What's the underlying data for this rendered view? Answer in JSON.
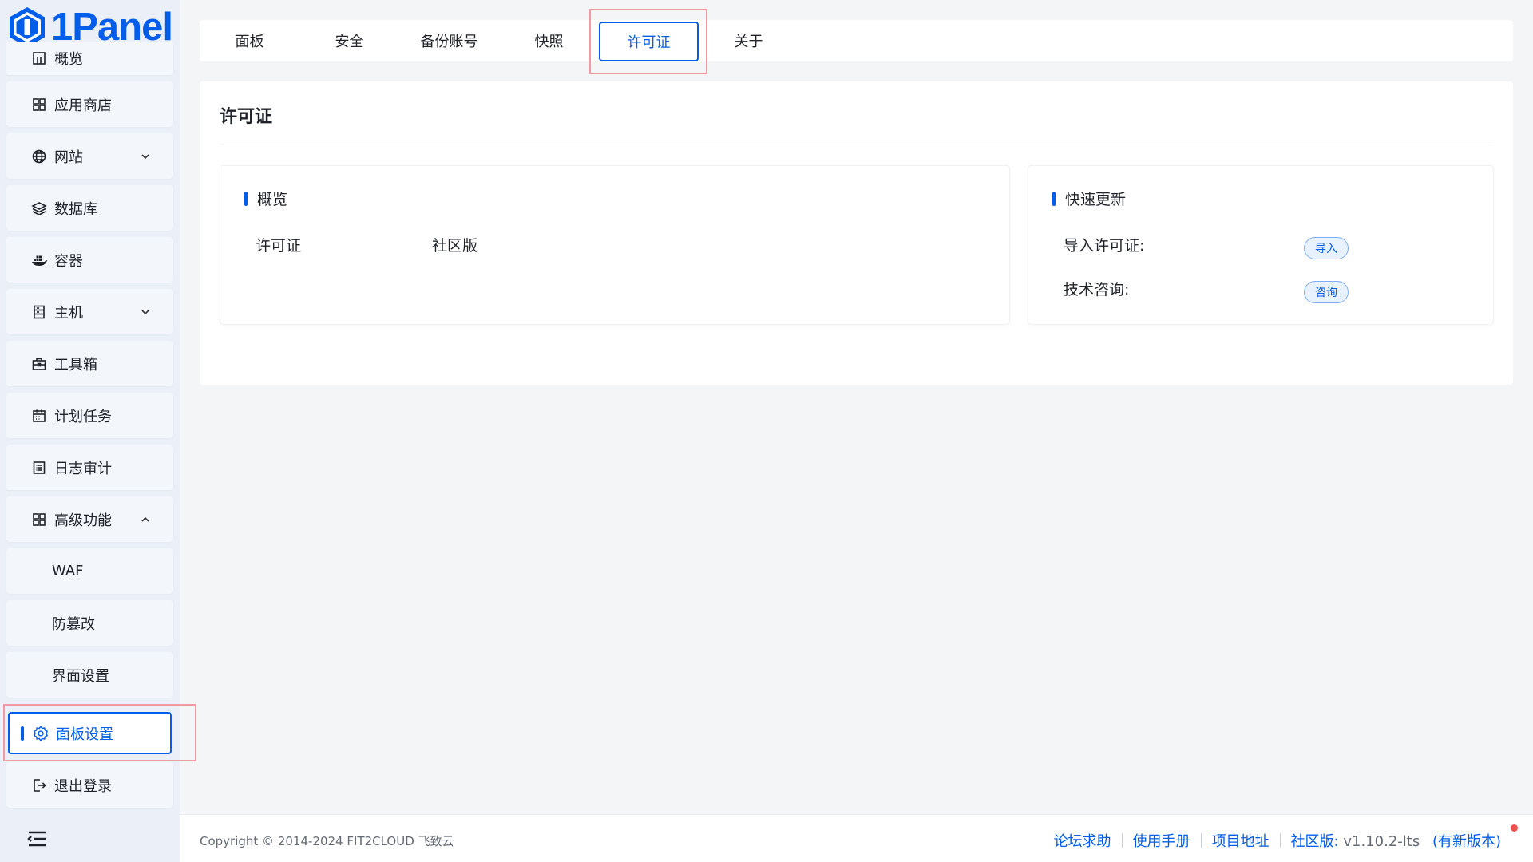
{
  "app": {
    "name": "1Panel"
  },
  "sidebar": {
    "items": [
      {
        "label": "概览",
        "icon": "dashboard-icon"
      },
      {
        "label": "应用商店",
        "icon": "grid-icon"
      },
      {
        "label": "网站",
        "icon": "globe-icon",
        "expandable": true
      },
      {
        "label": "数据库",
        "icon": "layers-icon"
      },
      {
        "label": "容器",
        "icon": "docker-icon"
      },
      {
        "label": "主机",
        "icon": "server-icon",
        "expandable": true
      },
      {
        "label": "工具箱",
        "icon": "toolbox-icon"
      },
      {
        "label": "计划任务",
        "icon": "calendar-icon"
      },
      {
        "label": "日志审计",
        "icon": "log-icon"
      },
      {
        "label": "高级功能",
        "icon": "grid-icon",
        "expanded": true
      },
      {
        "label": "WAF"
      },
      {
        "label": "防篡改"
      },
      {
        "label": "界面设置"
      },
      {
        "label": "面板设置",
        "icon": "gear-icon",
        "active": true
      },
      {
        "label": "退出登录",
        "icon": "logout-icon"
      }
    ]
  },
  "tabs": [
    {
      "label": "面板"
    },
    {
      "label": "安全"
    },
    {
      "label": "备份账号"
    },
    {
      "label": "快照"
    },
    {
      "label": "许可证",
      "active": true
    },
    {
      "label": "关于"
    }
  ],
  "main": {
    "title": "许可证",
    "overview": {
      "title": "概览",
      "license_label": "许可证",
      "license_value": "社区版"
    },
    "quick_update": {
      "title": "快速更新",
      "import_label": "导入许可证:",
      "import_button": "导入",
      "consult_label": "技术咨询:",
      "consult_button": "咨询"
    }
  },
  "footer": {
    "copyright": "Copyright © 2014-2024 FIT2CLOUD 飞致云",
    "links": [
      "论坛求助",
      "使用手册",
      "项目地址"
    ],
    "edition": "社区版:",
    "version": "v1.10.2-lts",
    "new_version": "(有新版本)"
  },
  "colors": {
    "accent": "#005eeb",
    "highlight": "#f19aa3",
    "sidebar_bg": "#ebf0f8"
  }
}
